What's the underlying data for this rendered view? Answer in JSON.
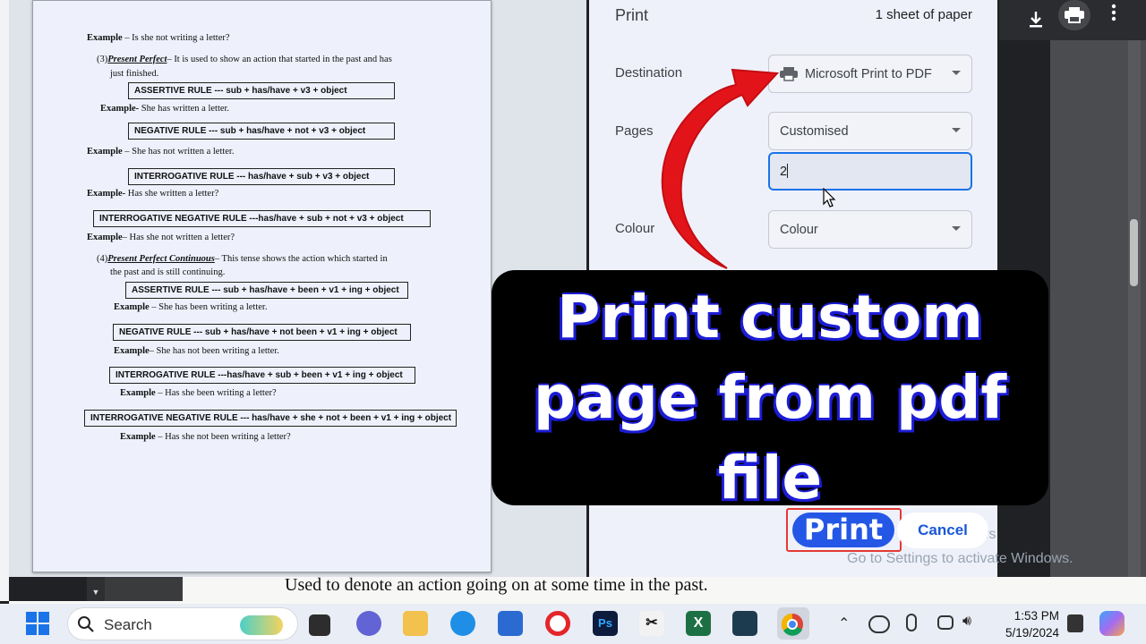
{
  "document": {
    "lines": [
      {
        "prefix": "Example",
        "sep": " – ",
        "text": "Is she not writing a letter?"
      },
      {
        "num": "(3)",
        "title": "Present Perfect",
        "text": "– It is used to show an action that started in the past and has"
      },
      {
        "text": "just finished."
      },
      {
        "prefix": "Example-",
        "sep": " ",
        "text": "She has written a letter."
      },
      {
        "prefix": "Example",
        "sep": " – ",
        "text": "She has not written a letter."
      },
      {
        "prefix": "Example-",
        "sep": " ",
        "text": "Has she written a letter?"
      },
      {
        "prefix": "Example",
        "sep": "– ",
        "text": "Has she not written a letter?"
      },
      {
        "num": "(4)",
        "title": "Present Perfect Continuous",
        "text": "– This tense shows the action which started in"
      },
      {
        "text": "the past and is still continuing."
      },
      {
        "prefix": "Example",
        "sep": " – ",
        "text": "She has been writing a letter."
      },
      {
        "prefix": "Example",
        "sep": "– ",
        "text": "She has not been writing a letter."
      },
      {
        "prefix": "Example",
        "sep": " – ",
        "text": "Has she been writing a letter?"
      },
      {
        "prefix": "Example",
        "sep": " – ",
        "text": "Has she not been writing a letter?"
      }
    ],
    "rules": [
      "ASSERTIVE RULE --- sub + has/have + v3 + object",
      "NEGATIVE RULE --- sub + has/have + not + v3 + object",
      "INTERROGATIVE RULE --- has/have + sub + v3 + object",
      "INTERROGATIVE NEGATIVE RULE ---has/have + sub + not + v3 + object",
      "ASSERTIVE RULE --- sub + has/have + been + v1 + ing + object",
      "NEGATIVE RULE --- sub + has/have + not been + v1 + ing + object",
      "INTERROGATIVE RULE ---has/have + sub + been + v1 + ing + object",
      "INTERROGATIVE NEGATIVE RULE --- has/have + she + not + been + v1 + ing + object"
    ],
    "bottom_text": "Used to denote an action going on at some time in the past."
  },
  "print_dialog": {
    "title": "Print",
    "sheets": "1 sheet of paper",
    "destination_label": "Destination",
    "destination_value": "Microsoft Print to PDF",
    "pages_label": "Pages",
    "pages_value": "Customised",
    "pages_input": "2",
    "colour_label": "Colour",
    "colour_value": "Colour",
    "print_button": "Print",
    "cancel_button": "Cancel"
  },
  "banner": {
    "line1": "Print custom",
    "line2": "page from pdf",
    "line3": "file"
  },
  "watermark": {
    "line1": "ws",
    "line2": "Go to Settings to activate Windows."
  },
  "taskbar": {
    "search_placeholder": "Search",
    "time": "1:53 PM",
    "date": "5/19/2024"
  },
  "colors": {
    "accent": "#1a73e8",
    "print_button": "#2457e6",
    "highlight_border": "#e53935",
    "arrow": "#e2141a",
    "banner_bg": "#000000"
  },
  "icons": [
    "download-icon",
    "printer-icon",
    "more-vert-icon",
    "windows-start-icon",
    "search-icon",
    "chevron-up-icon",
    "onedrive-icon",
    "mic-icon",
    "network-icon",
    "volume-icon"
  ]
}
